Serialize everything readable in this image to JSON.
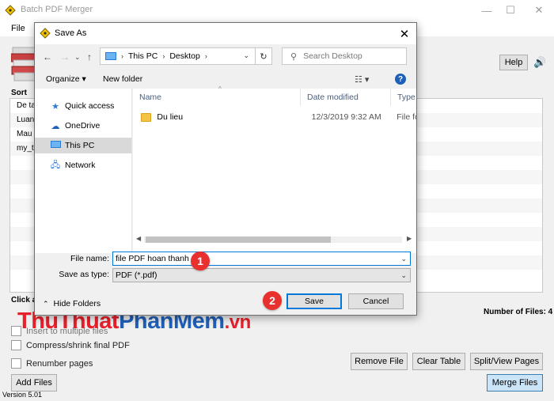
{
  "app": {
    "title": "Batch PDF Merger",
    "menu_file": "File",
    "help_label": "Help",
    "sort_label": "Sort",
    "file_rows": [
      "De ta",
      "Luan",
      "Mau t",
      "my_th"
    ],
    "click_label": "Click a",
    "num_files_label": "Number of Files: 4",
    "options": {
      "insert_multiple": "Insert to multiple files",
      "compress": "Compress/shrink final PDF",
      "renumber": "Renumber pages"
    },
    "buttons": {
      "add_files": "Add Files",
      "remove_file": "Remove File",
      "clear_table": "Clear Table",
      "split_view": "Split/View Pages",
      "merge_files": "Merge Files"
    },
    "version": "Version 5.01"
  },
  "watermark": {
    "part1": "Thu",
    "part2": "Thuat",
    "part3": "Phan",
    "part4": "Mem",
    "part5": ".vn"
  },
  "dialog": {
    "title": "Save As",
    "address": {
      "root": "This PC",
      "folder": "Desktop"
    },
    "search_placeholder": "Search Desktop",
    "organize": "Organize ▾",
    "new_folder": "New folder",
    "nav": [
      {
        "label": "Quick access",
        "icon": "star-icon"
      },
      {
        "label": "OneDrive",
        "icon": "cloud-icon"
      },
      {
        "label": "This PC",
        "icon": "computer-icon"
      },
      {
        "label": "Network",
        "icon": "network-icon"
      }
    ],
    "columns": {
      "name": "Name",
      "date": "Date modified",
      "type": "Type"
    },
    "rows": [
      {
        "name": "Du lieu",
        "date": "12/3/2019 9:32 AM",
        "type": "File fo"
      }
    ],
    "file_name_label": "File name:",
    "file_name_value": "file PDF hoan thanh",
    "save_type_label": "Save as type:",
    "save_type_value": "PDF (*.pdf)",
    "hide_folders": "Hide Folders",
    "save_button": "Save",
    "cancel_button": "Cancel"
  },
  "markers": {
    "one": "1",
    "two": "2"
  },
  "colors": {
    "accent": "#0078d7",
    "marker": "#e8302f",
    "folder": "#f5c342"
  }
}
